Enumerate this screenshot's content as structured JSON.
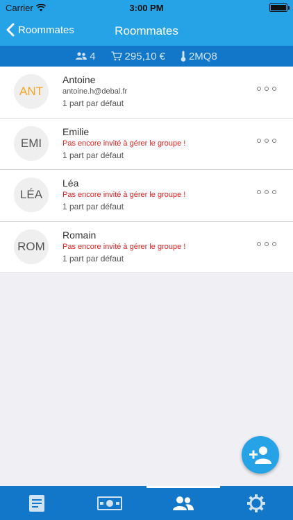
{
  "status_bar": {
    "carrier": "Carrier",
    "time": "3:00 PM"
  },
  "nav": {
    "back_label": "Roommates",
    "title": "Roommates"
  },
  "summary": {
    "members": "4",
    "total": "295,10 €",
    "code": "2MQ8"
  },
  "roommates": [
    {
      "initials": "ANT",
      "name": "Antoine",
      "email": "antoine.h@debal.fr",
      "part": "1 part par défaut"
    },
    {
      "initials": "EMI",
      "name": "Emilie",
      "email": "Pas encore invité à gérer le groupe !",
      "part": "1 part par défaut"
    },
    {
      "initials": "LÉA",
      "name": "Léa",
      "email": "Pas encore invité à gérer le groupe !",
      "part": "1 part par défaut"
    },
    {
      "initials": "ROM",
      "name": "Romain",
      "email": "Pas encore invité à gérer le groupe !",
      "part": "1 part par défaut"
    }
  ],
  "icons": {
    "members": "people-icon",
    "total": "cart-icon",
    "code": "thermometer-icon",
    "fab": "add-user-icon",
    "tabs": [
      "document-icon",
      "money-icon",
      "people-icon",
      "gear-icon"
    ]
  },
  "colors": {
    "accent": "#25a3e6",
    "bar": "#1377c9",
    "warning": "#e02020",
    "highlight": "#f5a623"
  }
}
